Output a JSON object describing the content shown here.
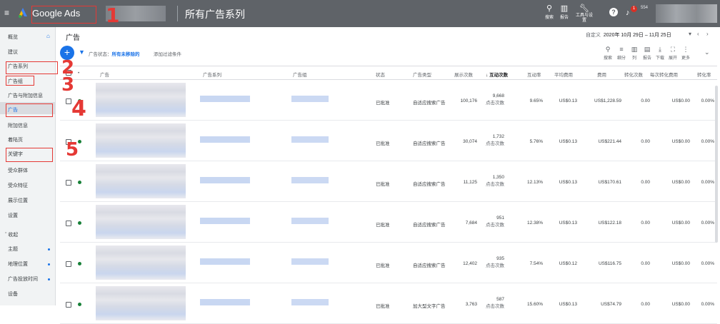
{
  "topbar": {
    "brand": "Google Ads",
    "title": "所有广告系列",
    "tools": [
      {
        "icon": "search-icon",
        "label": "搜索"
      },
      {
        "icon": "reports-icon",
        "label": "报告"
      },
      {
        "icon": "wrench-icon",
        "label": "工具与设置"
      }
    ],
    "notification_count": "1",
    "account_number": "554"
  },
  "annotations": [
    "1",
    "2",
    "3",
    "4",
    "5"
  ],
  "sidebar": {
    "items": [
      {
        "label": "概览"
      },
      {
        "label": "建议"
      },
      {
        "label": "广告系列"
      },
      {
        "label": "广告组"
      },
      {
        "label": "广告与附加信息"
      },
      {
        "label": "广告"
      },
      {
        "label": "附加信息"
      },
      {
        "label": "着陆页"
      },
      {
        "label": "关键字"
      },
      {
        "label": "受众群体"
      },
      {
        "label": "受众特征"
      },
      {
        "label": "展示位置"
      },
      {
        "label": "设置"
      },
      {
        "label": "收起"
      },
      {
        "label": "主题"
      },
      {
        "label": "地理位置"
      },
      {
        "label": "广告投放时间"
      },
      {
        "label": "设备"
      }
    ]
  },
  "main": {
    "page_title": "广告",
    "date_label": "自定义",
    "date_range": "2020年 10月 29日 – 11月 25日",
    "filter_label": "广告状态：",
    "filter_value": "所有未移除的",
    "add_filter": "添加过滤条件",
    "toolbar": [
      {
        "icon": "search-icon",
        "label": "搜索"
      },
      {
        "icon": "segment-icon",
        "label": "细分"
      },
      {
        "icon": "columns-icon",
        "label": "列"
      },
      {
        "icon": "reports-icon",
        "label": "报告"
      },
      {
        "icon": "download-icon",
        "label": "下载"
      },
      {
        "icon": "expand-icon",
        "label": "展开"
      },
      {
        "icon": "more-icon",
        "label": "更多"
      }
    ]
  },
  "table": {
    "headers": [
      "广告",
      "广告系列",
      "广告组",
      "状态",
      "广告类型",
      "展示次数",
      "互动次数",
      "互动率",
      "平均费用",
      "费用",
      "转化次数",
      "每次转化费用",
      "转化率"
    ],
    "rows": [
      {
        "status": "已批准",
        "type": "自适应搜索广告",
        "impressions": "100,176",
        "interactions": "9,668",
        "interactions_sub": "点击次数",
        "rate": "9.65%",
        "avg_cost": "US$0.13",
        "cost": "US$1,228.59",
        "conversions": "0.00",
        "cost_per_conv": "US$0.00",
        "conv_rate": "0.00%"
      },
      {
        "status": "已批准",
        "type": "自适应搜索广告",
        "impressions": "30,074",
        "interactions": "1,732",
        "interactions_sub": "点击次数",
        "rate": "5.76%",
        "avg_cost": "US$0.13",
        "cost": "US$221.44",
        "conversions": "0.00",
        "cost_per_conv": "US$0.00",
        "conv_rate": "0.00%"
      },
      {
        "status": "已批准",
        "type": "自适应搜索广告",
        "impressions": "11,125",
        "interactions": "1,350",
        "interactions_sub": "点击次数",
        "rate": "12.13%",
        "avg_cost": "US$0.13",
        "cost": "US$170.61",
        "conversions": "0.00",
        "cost_per_conv": "US$0.00",
        "conv_rate": "0.00%"
      },
      {
        "status": "已批准",
        "type": "自适应搜索广告",
        "impressions": "7,684",
        "interactions": "951",
        "interactions_sub": "点击次数",
        "rate": "12.38%",
        "avg_cost": "US$0.13",
        "cost": "US$122.18",
        "conversions": "0.00",
        "cost_per_conv": "US$0.00",
        "conv_rate": "0.00%"
      },
      {
        "status": "已批准",
        "type": "自适应搜索广告",
        "impressions": "12,402",
        "interactions": "935",
        "interactions_sub": "点击次数",
        "rate": "7.54%",
        "avg_cost": "US$0.12",
        "cost": "US$116.75",
        "conversions": "0.00",
        "cost_per_conv": "US$0.00",
        "conv_rate": "0.00%"
      },
      {
        "status": "已批准",
        "type": "加大型文字广告",
        "impressions": "3,763",
        "interactions": "587",
        "interactions_sub": "点击次数",
        "rate": "15.60%",
        "avg_cost": "US$0.13",
        "cost": "US$74.79",
        "conversions": "0.00",
        "cost_per_conv": "US$0.00",
        "conv_rate": "0.00%"
      }
    ]
  },
  "colors": {
    "brand_blue": "#1a73e8",
    "topbar": "#5f6368",
    "annotation_red": "#e53935",
    "enabled_green": "#188038"
  }
}
